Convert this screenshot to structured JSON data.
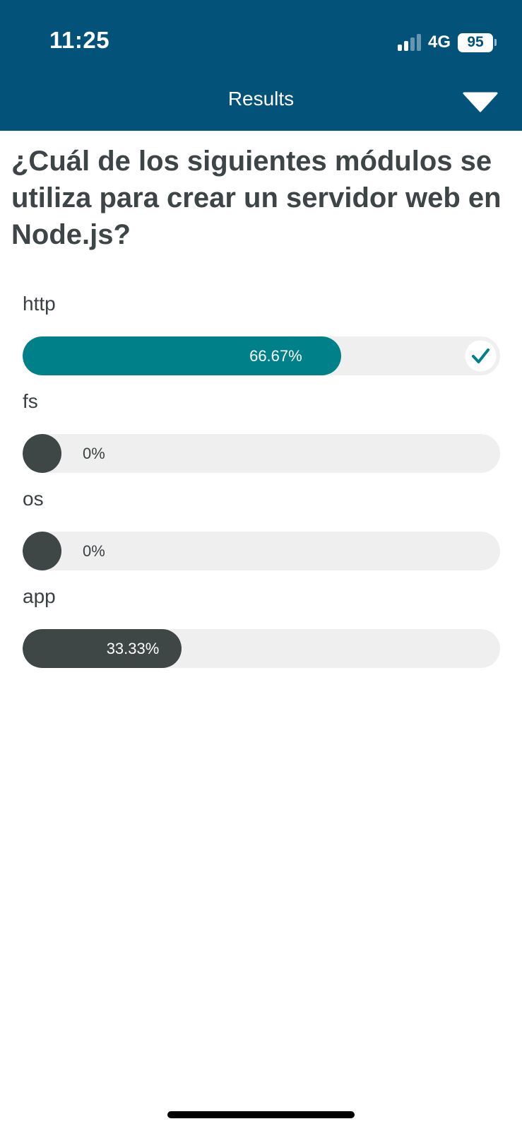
{
  "status_bar": {
    "time": "11:25",
    "network": "4G",
    "battery": "95",
    "signal_bars_active": 2,
    "signal_bars_total": 4
  },
  "header": {
    "title": "Results",
    "background_color": "#03527a",
    "collapse_icon": "chevron-down-icon"
  },
  "question": "¿Cuál de los siguientes módulos se utiliza para crear un servidor web en Node.js?",
  "options": [
    {
      "label": "http",
      "percent": 66.67,
      "percent_text": "66.67%",
      "correct": true,
      "fill_color": "#00818a"
    },
    {
      "label": "fs",
      "percent": 0,
      "percent_text": "0%",
      "correct": false,
      "fill_color": "#3f4646"
    },
    {
      "label": "os",
      "percent": 0,
      "percent_text": "0%",
      "correct": false,
      "fill_color": "#3f4646"
    },
    {
      "label": "app",
      "percent": 33.33,
      "percent_text": "33.33%",
      "correct": false,
      "fill_color": "#3f4646"
    }
  ],
  "colors": {
    "track": "#efefef",
    "text": "#3d4546",
    "correct_accent": "#00818a"
  }
}
